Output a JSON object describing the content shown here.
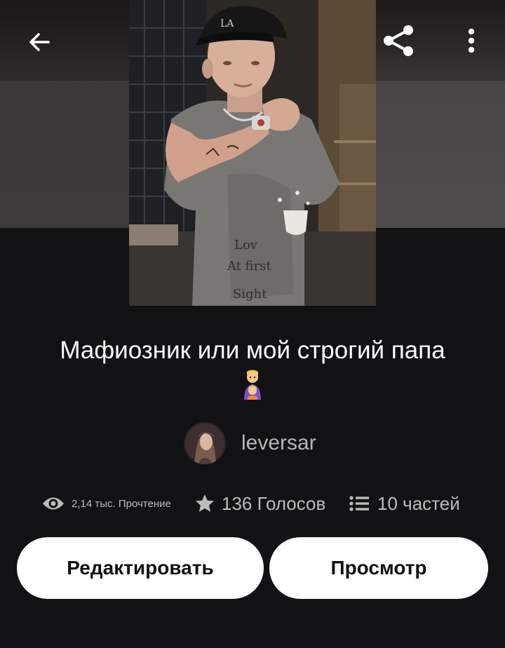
{
  "header": {
    "back_icon": "arrow-left-icon",
    "share_icon": "share-icon",
    "more_icon": "more-vert-icon"
  },
  "story": {
    "title": "Мафиозник или мой строгий папа",
    "title_emoji": "father-with-child-emoji"
  },
  "author": {
    "name": "leversar"
  },
  "stats": {
    "reads_icon": "eye-icon",
    "reads": "2,14 тыс. Прочтение",
    "votes_icon": "star-icon",
    "votes": "136 Голосов",
    "parts_icon": "list-icon",
    "parts": "10 частей"
  },
  "actions": {
    "edit_label": "Редактировать",
    "view_label": "Просмотр"
  },
  "colors": {
    "background": "#121114",
    "button_bg": "#ffffff",
    "button_text": "#111111",
    "muted_text": "#bdbbbb"
  }
}
